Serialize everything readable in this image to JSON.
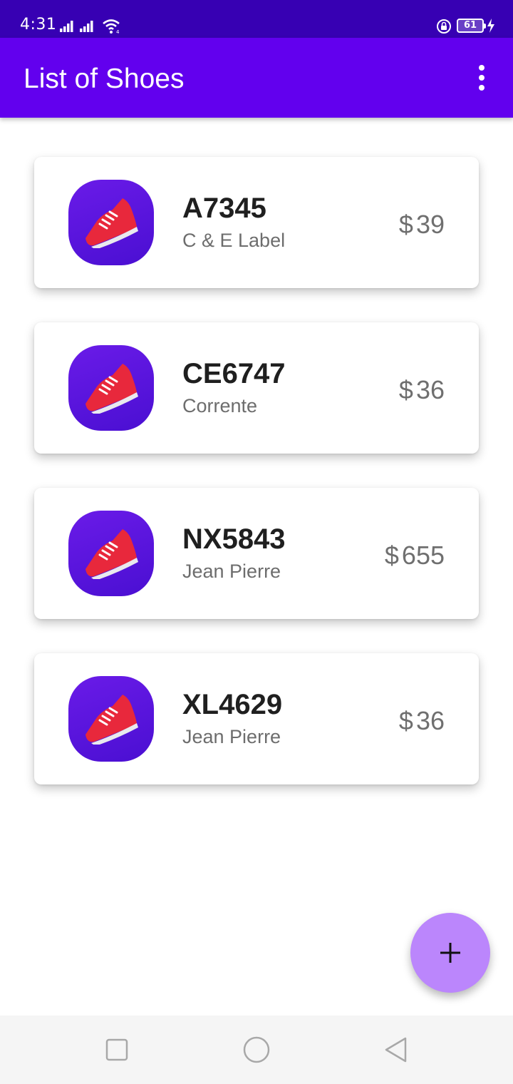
{
  "status_bar": {
    "time": "4:31",
    "battery": "61",
    "icons": [
      "signal-icon",
      "signal-icon",
      "wifi-icon",
      "lock-rotation-icon",
      "battery-icon",
      "charging-icon"
    ]
  },
  "app_bar": {
    "title": "List of Shoes",
    "menu_icon": "more-vert-icon"
  },
  "shoes": [
    {
      "code": "A7345",
      "brand": "C & E Label",
      "currency": "$",
      "price": "39",
      "icon": "shoe-icon"
    },
    {
      "code": "CE6747",
      "brand": "Corrente",
      "currency": "$",
      "price": "36",
      "icon": "shoe-icon"
    },
    {
      "code": "NX5843",
      "brand": "Jean Pierre",
      "currency": "$",
      "price": "655",
      "icon": "shoe-icon"
    },
    {
      "code": "XL4629",
      "brand": "Jean Pierre",
      "currency": "$",
      "price": "36",
      "icon": "shoe-icon"
    }
  ],
  "fab": {
    "icon": "add-icon"
  },
  "nav_bar": {
    "icons": [
      "recents-square-icon",
      "home-circle-icon",
      "back-triangle-icon"
    ]
  },
  "colors": {
    "status_bar": "#3700b3",
    "app_bar": "#6200ee",
    "fab": "#bb86fc",
    "shoe_tile": "#5a14e0",
    "shoe": "#e8283c"
  }
}
